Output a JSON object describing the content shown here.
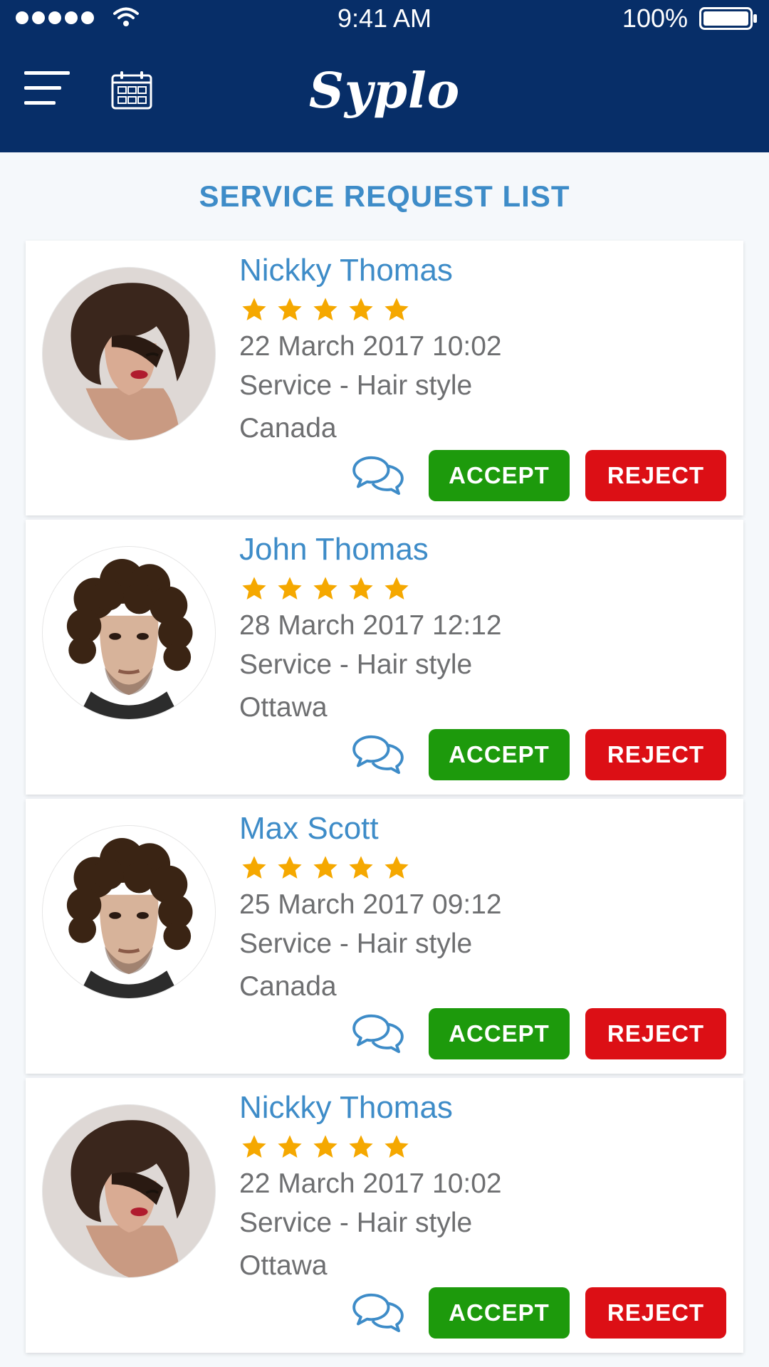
{
  "status_bar": {
    "time": "9:41 AM",
    "battery": "100%"
  },
  "header": {
    "app_name": "Syplo",
    "menu_icon": "hamburger-menu-icon",
    "calendar_icon": "calendar-icon"
  },
  "page": {
    "title": "SERVICE REQUEST LIST"
  },
  "requests": [
    {
      "name": "Nickky Thomas",
      "rating": 5,
      "date": "22 March 2017 10:02",
      "service": "Service - Hair style",
      "location": "Canada",
      "accept_label": "ACCEPT",
      "reject_label": "REJECT"
    },
    {
      "name": "John Thomas",
      "rating": 5,
      "date": "28 March 2017 12:12",
      "service": "Service - Hair style",
      "location": "Ottawa",
      "accept_label": "ACCEPT",
      "reject_label": "REJECT"
    },
    {
      "name": "Max Scott",
      "rating": 5,
      "date": "25 March 2017 09:12",
      "service": "Service - Hair style",
      "location": "Canada",
      "accept_label": "ACCEPT",
      "reject_label": "REJECT"
    },
    {
      "name": "Nickky Thomas",
      "rating": 5,
      "date": "22 March 2017 10:02",
      "service": "Service - Hair style",
      "location": "Ottawa",
      "accept_label": "ACCEPT",
      "reject_label": "REJECT"
    }
  ],
  "colors": {
    "header_bg": "#072e68",
    "accent_blue": "#3e8cc8",
    "accept_green": "#1d9a0c",
    "reject_red": "#dc0f15",
    "star_gold": "#f5a800"
  }
}
